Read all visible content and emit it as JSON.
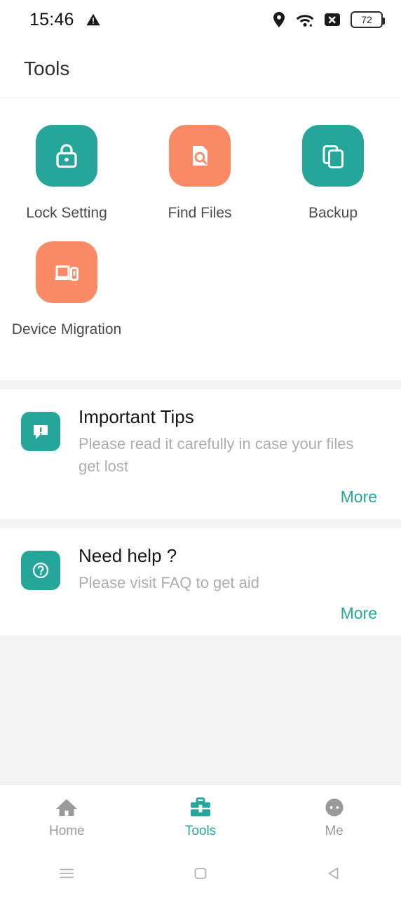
{
  "status_bar": {
    "time": "15:46",
    "warning_icon": "warning-triangle-icon",
    "location_icon": "location-pin-icon",
    "wifi_icon": "wifi-icon",
    "sim_icon": "no-sim-icon",
    "battery_level": "72"
  },
  "app_bar": {
    "title": "Tools"
  },
  "tools": {
    "items": [
      {
        "label": "Lock Setting",
        "icon": "lock-icon",
        "color": "#26a69a"
      },
      {
        "label": "Find Files",
        "icon": "file-search-icon",
        "color": "#fa8a66"
      },
      {
        "label": "Backup",
        "icon": "copy-documents-icon",
        "color": "#26a69a"
      },
      {
        "label": "Device Migration",
        "icon": "devices-transfer-icon",
        "color": "#fa8a66"
      }
    ]
  },
  "info_cards": [
    {
      "title": "Important Tips",
      "description": "Please read it carefully in case your files get lost",
      "more_label": "More",
      "icon": "speech-bubble-alert-icon",
      "icon_color": "#26a69a"
    },
    {
      "title": "Need help ?",
      "description": "Please visit FAQ to get aid",
      "more_label": "More",
      "icon": "question-mark-circle-icon",
      "icon_color": "#26a69a"
    }
  ],
  "bottom_nav": {
    "items": [
      {
        "label": "Home",
        "icon": "home-icon",
        "active": false
      },
      {
        "label": "Tools",
        "icon": "briefcase-icon",
        "active": true
      },
      {
        "label": "Me",
        "icon": "person-avatar-icon",
        "active": false
      }
    ],
    "active_color": "#26a69a",
    "inactive_color": "#9a9a9a"
  },
  "system_nav": {
    "recents_icon": "menu-lines-icon",
    "home_icon": "square-icon",
    "back_icon": "back-triangle-icon"
  }
}
